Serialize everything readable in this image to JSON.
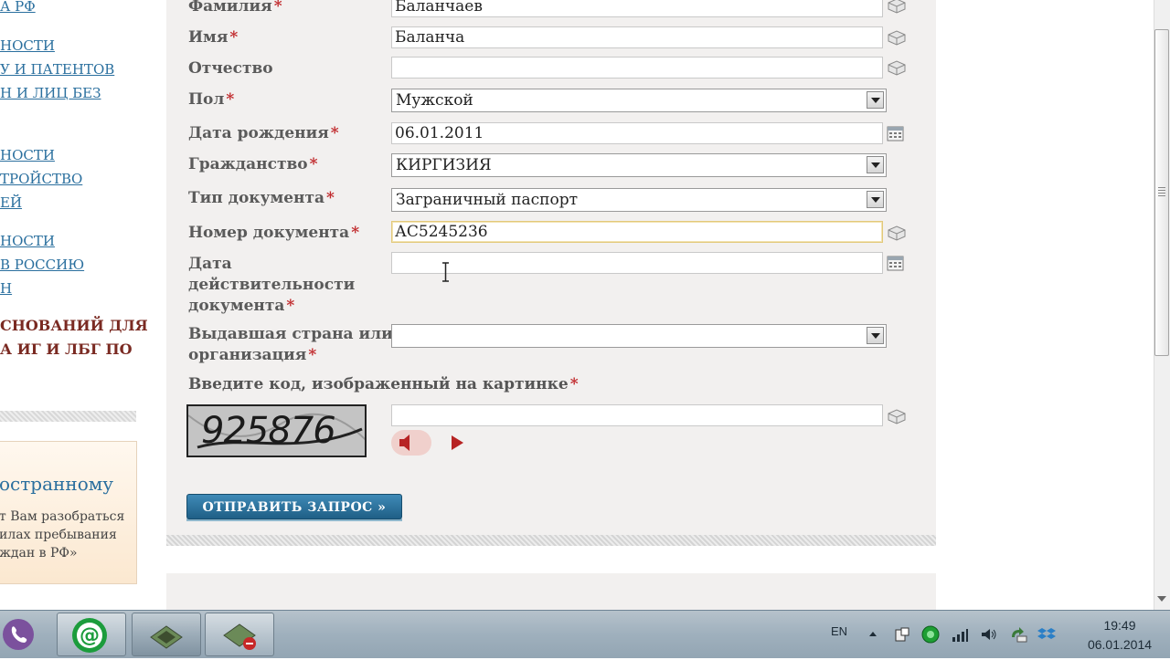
{
  "sidebar": {
    "links": [
      {
        "id": "rf",
        "label": "А РФ"
      },
      {
        "id": "l1",
        "label": "НОСТИ"
      },
      {
        "id": "l2",
        "label": "У И ПАТЕНТОВ"
      },
      {
        "id": "l3",
        "label": "Н И ЛИЦ БЕЗ"
      },
      {
        "id": "l4",
        "label": "НОСТИ"
      },
      {
        "id": "l5",
        "label": "ТРОЙСТВО"
      },
      {
        "id": "l6",
        "label": "ЕЙ"
      },
      {
        "id": "l7",
        "label": "НОСТИ"
      },
      {
        "id": "l8",
        "label": "В РОССИЮ"
      },
      {
        "id": "l9",
        "label": "Н"
      }
    ],
    "bold_lines": [
      "СНОВАНИЙ ДЛЯ",
      "А ИГ И ЛБГ ПО"
    ],
    "promo": {
      "title": "остранному",
      "text": "т Вам разобраться\nилах пребывания\nждан в РФ»"
    }
  },
  "form": {
    "required_mark": "*",
    "fields": {
      "surname": {
        "label": "Фамилия",
        "value": "Баланчаев"
      },
      "name": {
        "label": "Имя",
        "value": "Баланча"
      },
      "patronymic": {
        "label": "Отчество",
        "value": ""
      },
      "gender": {
        "label": "Пол",
        "value": "Мужской"
      },
      "birth_date": {
        "label": "Дата рождения",
        "value": "06.01.2011"
      },
      "citizenship": {
        "label": "Гражданство",
        "value": "КИРГИЗИЯ"
      },
      "doc_type": {
        "label": "Тип документа",
        "value": "Заграничный паспорт"
      },
      "doc_number": {
        "label": "Номер документа",
        "value": "АС5245236"
      },
      "doc_validity": {
        "label_lines": [
          "Дата",
          "действительности",
          "документа"
        ],
        "value": ""
      },
      "issuer": {
        "label_lines": [
          "Выдавшая страна или",
          "организация"
        ],
        "value": ""
      },
      "captcha": {
        "label": "Введите код, изображенный на картинке",
        "image_text": "925876",
        "value": ""
      }
    },
    "submit_label": "ОТПРАВИТЬ ЗАПРОС »"
  },
  "taskbar": {
    "apps": [
      "viber-icon",
      "mail-agent-icon",
      "folder-app-icon",
      "archive-app-icon"
    ],
    "language": "EN",
    "time": "19:49",
    "date": "06.01.2014"
  },
  "colors": {
    "link": "#2a6f9e",
    "required": "#c0282b",
    "button": "#2a6f9e",
    "panel": "#f2f0ef"
  }
}
